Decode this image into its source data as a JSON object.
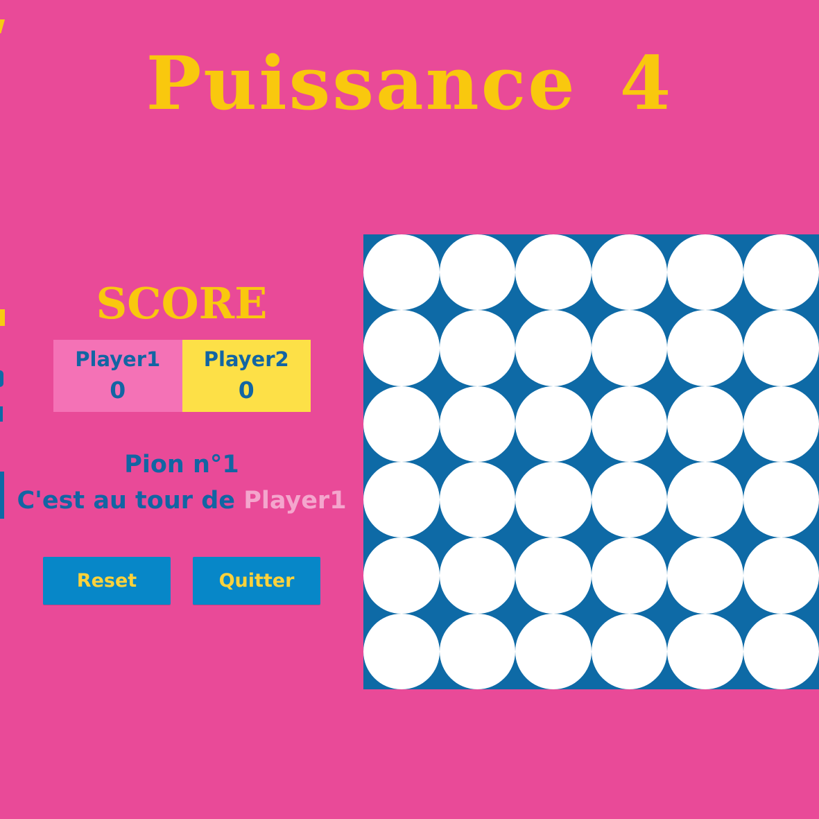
{
  "title": "Puissance 4",
  "score": {
    "title": "SCORE",
    "player1": {
      "name": "Player1",
      "points": "0"
    },
    "player2": {
      "name": "Player2",
      "points": "0"
    }
  },
  "turn": {
    "pion_label": "Pion n°1",
    "prompt": "C'est au tour de",
    "current_player": "Player1"
  },
  "buttons": {
    "reset": "Reset",
    "quit": "Quitter"
  },
  "board": {
    "rows": 6,
    "columns": 6,
    "cells": [
      [
        "empty",
        "empty",
        "empty",
        "empty",
        "empty",
        "empty"
      ],
      [
        "empty",
        "empty",
        "empty",
        "empty",
        "empty",
        "empty"
      ],
      [
        "empty",
        "empty",
        "empty",
        "empty",
        "empty",
        "empty"
      ],
      [
        "empty",
        "empty",
        "empty",
        "empty",
        "empty",
        "empty"
      ],
      [
        "empty",
        "empty",
        "empty",
        "empty",
        "empty",
        "empty"
      ],
      [
        "empty",
        "empty",
        "empty",
        "empty",
        "empty",
        "empty"
      ]
    ]
  },
  "colors": {
    "background": "#e94a98",
    "title": "#f9c80e",
    "board": "#0e6aa6",
    "empty_slot": "#ffffff",
    "player1_cell": "#f472b6",
    "player2_cell": "#fde047",
    "button": "#0787c8",
    "button_text": "#fcd23b",
    "text": "#1265a3",
    "current_player_text": "#f4a6cd"
  }
}
